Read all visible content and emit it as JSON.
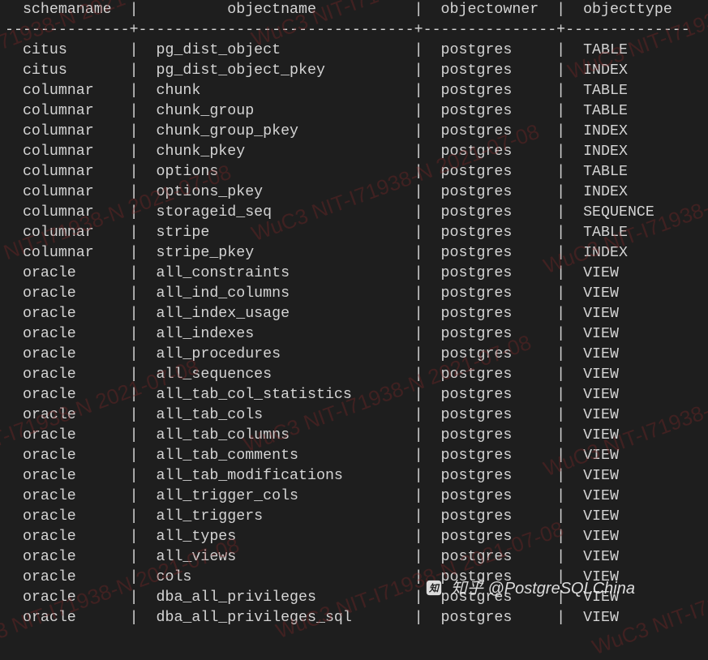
{
  "columns": {
    "c1": "schemaname",
    "c2": "objectname",
    "c3": "objectowner",
    "c4": "objecttype"
  },
  "rows": [
    {
      "schemaname": "citus",
      "objectname": "pg_dist_object",
      "objectowner": "postgres",
      "objecttype": "TABLE"
    },
    {
      "schemaname": "citus",
      "objectname": "pg_dist_object_pkey",
      "objectowner": "postgres",
      "objecttype": "INDEX"
    },
    {
      "schemaname": "columnar",
      "objectname": "chunk",
      "objectowner": "postgres",
      "objecttype": "TABLE"
    },
    {
      "schemaname": "columnar",
      "objectname": "chunk_group",
      "objectowner": "postgres",
      "objecttype": "TABLE"
    },
    {
      "schemaname": "columnar",
      "objectname": "chunk_group_pkey",
      "objectowner": "postgres",
      "objecttype": "INDEX"
    },
    {
      "schemaname": "columnar",
      "objectname": "chunk_pkey",
      "objectowner": "postgres",
      "objecttype": "INDEX"
    },
    {
      "schemaname": "columnar",
      "objectname": "options",
      "objectowner": "postgres",
      "objecttype": "TABLE"
    },
    {
      "schemaname": "columnar",
      "objectname": "options_pkey",
      "objectowner": "postgres",
      "objecttype": "INDEX"
    },
    {
      "schemaname": "columnar",
      "objectname": "storageid_seq",
      "objectowner": "postgres",
      "objecttype": "SEQUENCE"
    },
    {
      "schemaname": "columnar",
      "objectname": "stripe",
      "objectowner": "postgres",
      "objecttype": "TABLE"
    },
    {
      "schemaname": "columnar",
      "objectname": "stripe_pkey",
      "objectowner": "postgres",
      "objecttype": "INDEX"
    },
    {
      "schemaname": "oracle",
      "objectname": "all_constraints",
      "objectowner": "postgres",
      "objecttype": "VIEW"
    },
    {
      "schemaname": "oracle",
      "objectname": "all_ind_columns",
      "objectowner": "postgres",
      "objecttype": "VIEW"
    },
    {
      "schemaname": "oracle",
      "objectname": "all_index_usage",
      "objectowner": "postgres",
      "objecttype": "VIEW"
    },
    {
      "schemaname": "oracle",
      "objectname": "all_indexes",
      "objectowner": "postgres",
      "objecttype": "VIEW"
    },
    {
      "schemaname": "oracle",
      "objectname": "all_procedures",
      "objectowner": "postgres",
      "objecttype": "VIEW"
    },
    {
      "schemaname": "oracle",
      "objectname": "all_sequences",
      "objectowner": "postgres",
      "objecttype": "VIEW"
    },
    {
      "schemaname": "oracle",
      "objectname": "all_tab_col_statistics",
      "objectowner": "postgres",
      "objecttype": "VIEW"
    },
    {
      "schemaname": "oracle",
      "objectname": "all_tab_cols",
      "objectowner": "postgres",
      "objecttype": "VIEW"
    },
    {
      "schemaname": "oracle",
      "objectname": "all_tab_columns",
      "objectowner": "postgres",
      "objecttype": "VIEW"
    },
    {
      "schemaname": "oracle",
      "objectname": "all_tab_comments",
      "objectowner": "postgres",
      "objecttype": "VIEW"
    },
    {
      "schemaname": "oracle",
      "objectname": "all_tab_modifications",
      "objectowner": "postgres",
      "objecttype": "VIEW"
    },
    {
      "schemaname": "oracle",
      "objectname": "all_trigger_cols",
      "objectowner": "postgres",
      "objecttype": "VIEW"
    },
    {
      "schemaname": "oracle",
      "objectname": "all_triggers",
      "objectowner": "postgres",
      "objecttype": "VIEW"
    },
    {
      "schemaname": "oracle",
      "objectname": "all_types",
      "objectowner": "postgres",
      "objecttype": "VIEW"
    },
    {
      "schemaname": "oracle",
      "objectname": "all_views",
      "objectowner": "postgres",
      "objecttype": "VIEW"
    },
    {
      "schemaname": "oracle",
      "objectname": "cols",
      "objectowner": "postgres",
      "objecttype": "VIEW"
    },
    {
      "schemaname": "oracle",
      "objectname": "dba_all_privileges",
      "objectowner": "postgres",
      "objecttype": "VIEW"
    },
    {
      "schemaname": "oracle",
      "objectname": "dba_all_privileges_sql",
      "objectowner": "postgres",
      "objecttype": "VIEW"
    }
  ],
  "layout": {
    "col1_inner": 12,
    "col2_inner": 29,
    "col3_inner": 13,
    "col4_inner": 12
  },
  "watermark": {
    "text": "WuC3 NIT-I71938-N 2021-07-08",
    "attribution_label": "知乎",
    "attribution_handle": "@PostgreSQLChina"
  }
}
